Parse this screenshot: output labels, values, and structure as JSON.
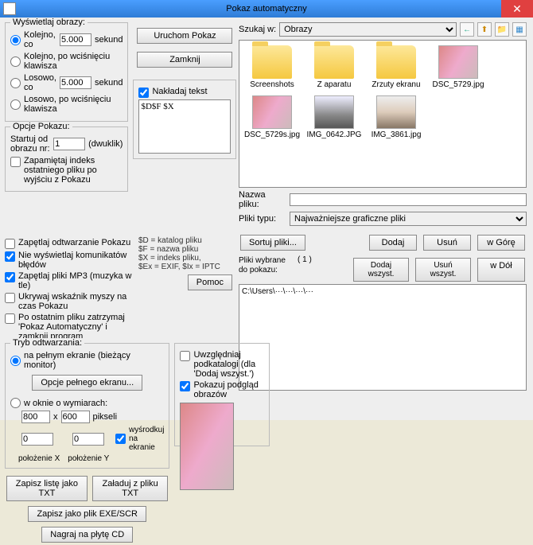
{
  "title": "Pokaz automatyczny",
  "display_images": {
    "group": "Wyświetlaj obrazy:",
    "seq_each": "Kolejno, co",
    "seconds": "sekund",
    "seq_key": "Kolejno, po wciśnięciu klawisza",
    "rand_each": "Losowo, co",
    "rand_key": "Losowo, po wciśnięciu klawisza",
    "val1": "5.000",
    "val2": "5.000"
  },
  "show_opts": {
    "group": "Opcje Pokazu:",
    "start_from": "Startuj od obrazu nr:",
    "start_val": "1",
    "dblclick": "(dwuklik)",
    "remember": "Zapamiętaj indeks ostatniego pliku po wyjściu z Pokazu"
  },
  "buttons": {
    "run": "Uruchom Pokaz",
    "close": "Zamknij",
    "help": "Pomoc",
    "full_opts": "Opcje pełnego ekranu...",
    "save_txt": "Zapisz listę jako TXT",
    "load_txt": "Załaduj z pliku TXT",
    "save_exe": "Zapisz jako plik EXE/SCR",
    "burn_cd": "Nagraj na płytę CD"
  },
  "overlay": {
    "label": "Nakładaj tekst",
    "text": "$D$F $X"
  },
  "placeholders": {
    "hints": "$D = katalog pliku\n$F = nazwa pliku\n$X = indeks pliku,\n$Ex = EXIF, $Ix = IPTC"
  },
  "loop_opts": {
    "loop": "Zapętlaj odtwarzanie Pokazu",
    "no_err": "Nie wyświetlaj komunikatów błędów",
    "mp3": "Zapętlaj pliki MP3 (muzyka w tle)",
    "hide_mouse": "Ukrywaj wskaźnik myszy na czas Pokazu",
    "stop_last": "Po ostatnim pliku zatrzymaj 'Pokaz Automatyczny' i zamknij program"
  },
  "play_mode": {
    "group": "Tryb odtwarzania:",
    "fullscreen": "na pełnym ekranie (bieżący monitor)",
    "window": "w oknie o wymiarach:",
    "w": "800",
    "x": "x",
    "h": "600",
    "px": "pikseli",
    "px_x": "0",
    "px_y": "0",
    "posx": "położenie X",
    "posy": "położenie Y",
    "centerscreen": "wyśrodkuj na ekranie"
  },
  "right_opts": {
    "subfolders": "Uwzględniaj podkatalogi (dla 'Dodaj wszyst.')",
    "preview": "Pokazuj podgląd obrazów"
  },
  "search": {
    "label": "Szukaj w:",
    "combo": "Obrazy"
  },
  "files": {
    "items": [
      {
        "type": "folder",
        "name": "Screenshots"
      },
      {
        "type": "folder",
        "name": "Z aparatu"
      },
      {
        "type": "folder",
        "name": "Zrzuty ekranu"
      },
      {
        "type": "img",
        "name": "DSC_5729.jpg",
        "cls": "pink"
      },
      {
        "type": "img",
        "name": "DSC_5729s.jpg",
        "cls": "pink"
      },
      {
        "type": "img",
        "name": "IMG_0642.JPG",
        "cls": "city"
      },
      {
        "type": "img",
        "name": "IMG_3861.jpg",
        "cls": "woman"
      }
    ]
  },
  "filefields": {
    "name_label": "Nazwa pliku:",
    "name_val": "",
    "type_label": "Pliki typu:",
    "type_val": "Najważniejsze graficzne pliki"
  },
  "list_btns": {
    "sort": "Sortuj pliki...",
    "add": "Dodaj",
    "remove": "Usuń",
    "up": "w Górę",
    "add_all": "Dodaj wszyst.",
    "remove_all": "Usuń wszyst.",
    "down": "w Dół"
  },
  "selected": {
    "label": "Pliki wybrane do pokazu:",
    "count": "( 1 )",
    "path": "C:\\Users\\···\\···\\···\\···"
  }
}
